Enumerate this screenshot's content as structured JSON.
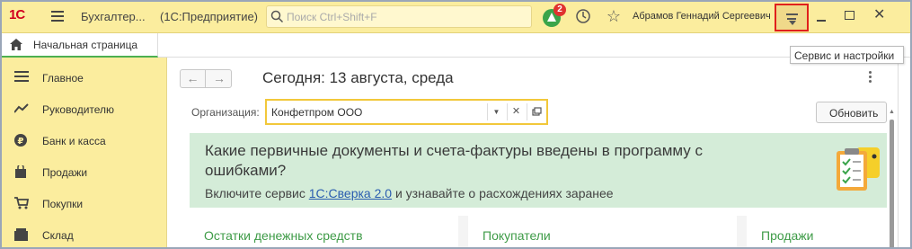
{
  "titlebar": {
    "logo": "1С",
    "app_name": "Бухгалтер...",
    "platform": "(1С:Предприятие)",
    "search_placeholder": "Поиск Ctrl+Shift+F",
    "notifications_count": "2",
    "user": "Абрамов Геннадий Сергеевич"
  },
  "tabs": {
    "home_label": "Начальная страница"
  },
  "tooltip": "Сервис и настройки",
  "sidebar": {
    "items": [
      {
        "label": "Главное",
        "icon": "menu-lines-icon"
      },
      {
        "label": "Руководителю",
        "icon": "trend-icon"
      },
      {
        "label": "Банк и касса",
        "icon": "ruble-coin-icon"
      },
      {
        "label": "Продажи",
        "icon": "bag-icon"
      },
      {
        "label": "Покупки",
        "icon": "cart-icon"
      },
      {
        "label": "Склад",
        "icon": "box-icon"
      }
    ]
  },
  "main": {
    "page_title": "Сегодня: 13 августа, среда",
    "org_label": "Организация:",
    "org_value": "Конфетпром ООО",
    "refresh_label": "Обновить",
    "banner": {
      "title": "Какие первичные документы и счета-фактуры введены в программу с ошибками?",
      "text_before": "Включите сервис ",
      "link": "1С:Сверка 2.0",
      "text_after": " и узнавайте о расхождениях заранее"
    },
    "widgets": [
      "Остатки денежных средств",
      "Покупатели",
      "Продажи"
    ]
  },
  "colors": {
    "chrome": "#fbed9e",
    "banner": "#d4ecd8",
    "link": "#2a5db0",
    "widget_title": "#3e9b47",
    "highlight": "#e0201c"
  }
}
